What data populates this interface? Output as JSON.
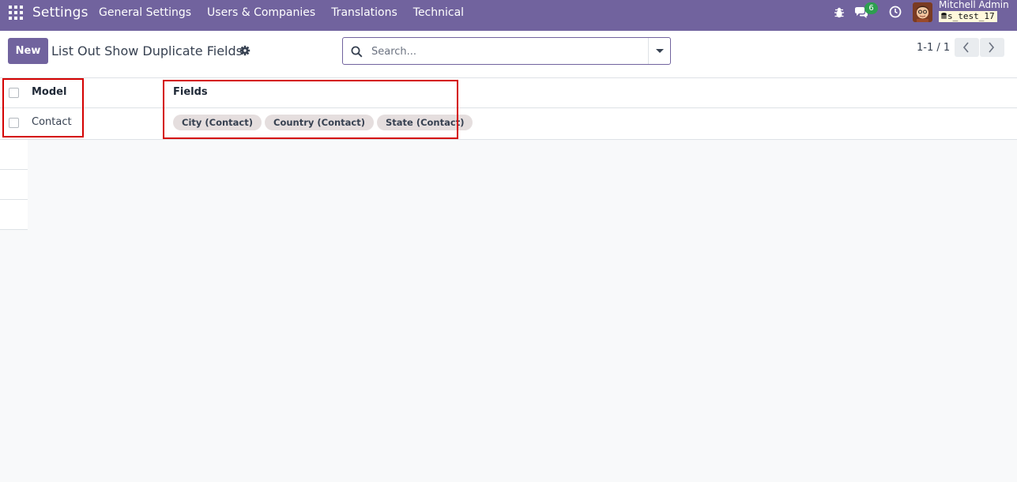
{
  "navbar": {
    "brand": "Settings",
    "menu": [
      {
        "label": "General Settings"
      },
      {
        "label": "Users & Companies"
      },
      {
        "label": "Translations"
      },
      {
        "label": "Technical"
      }
    ],
    "chat_count": "6",
    "user_name": "Mitchell Admin",
    "db_name": "s_test_17"
  },
  "control_panel": {
    "new_label": "New",
    "title": "List Out Show Duplicate Fields",
    "search_placeholder": "Search...",
    "pager": "1-1 / 1"
  },
  "list": {
    "columns": [
      "Model",
      "Fields"
    ],
    "rows": [
      {
        "model": "Contact",
        "fields": [
          "City (Contact)",
          "Country (Contact)",
          "State (Contact)"
        ]
      }
    ]
  },
  "colors": {
    "brand": "#71639e",
    "highlight": "#d40000"
  }
}
